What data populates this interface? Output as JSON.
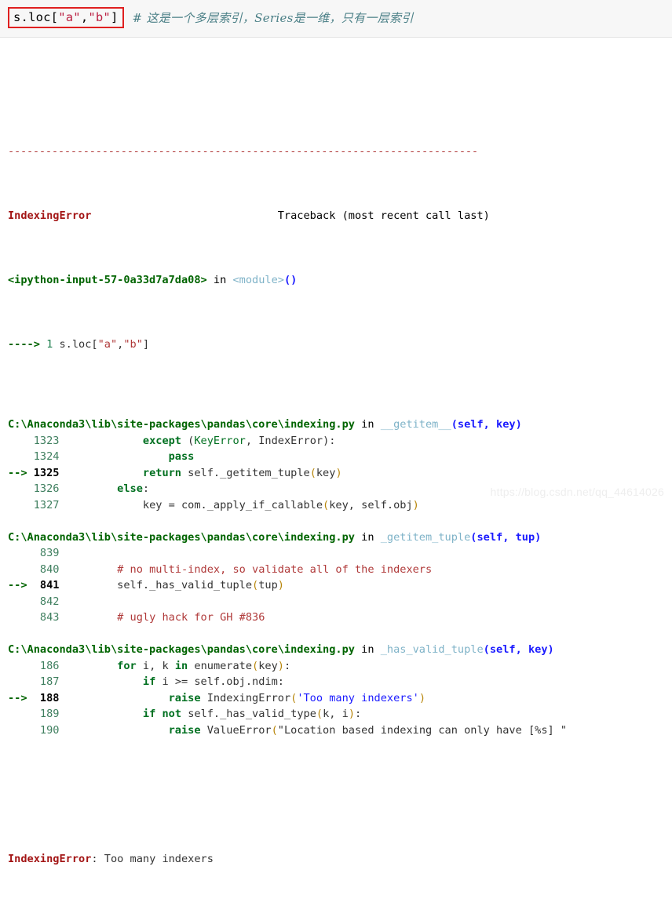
{
  "input_cell": {
    "code_prefix": "s.loc[",
    "code_str_a": "\"a\"",
    "code_comma": ",",
    "code_str_b": "\"b\"",
    "code_suffix": "]",
    "code_full": "s.loc[\"a\",\"b\"]",
    "comment": "# 这是一个多层索引，Series是一维，只有一层索引",
    "highlight_color": "#e02020",
    "background": "#f7f7f7"
  },
  "traceback": {
    "separator": "---------------------------------------------------------------------------",
    "exception_name": "IndexingError",
    "header_right": "Traceback (most recent call last)",
    "cell_ref": "<ipython-input-57-0a33d7a7da08>",
    "cell_in": " in ",
    "cell_scope": "<module>",
    "cell_parens": "()",
    "call_arrow": "----> ",
    "call_lineno": "1 ",
    "call_code_prefix": "s.loc[",
    "call_str_a": "\"a\"",
    "call_comma": ",",
    "call_str_b": "\"b\"",
    "call_suffix": "]",
    "frames": [
      {
        "path": "C:\\Anaconda3\\lib\\site-packages\\pandas\\core\\indexing.py",
        "in": " in ",
        "func": "__getitem__",
        "args": "(self, key)",
        "lines": [
          {
            "marker": "   ",
            "no": "1323",
            "current": false,
            "indent": "            ",
            "tokens": [
              {
                "t": "except",
                "c": "kw"
              },
              {
                "t": " (",
                "c": "plain"
              },
              {
                "t": "KeyError",
                "c": "builtin"
              },
              {
                "t": ", ",
                "c": "plain"
              },
              {
                "t": "IndexError",
                "c": "ident"
              },
              {
                "t": "):",
                "c": "plain"
              }
            ]
          },
          {
            "marker": "   ",
            "no": "1324",
            "current": false,
            "indent": "                ",
            "tokens": [
              {
                "t": "pass",
                "c": "kw"
              }
            ]
          },
          {
            "marker": "-> ",
            "no": "1325",
            "current": true,
            "indent": "            ",
            "tokens": [
              {
                "t": "return",
                "c": "kw"
              },
              {
                "t": " self._getitem_tuple",
                "c": "ident"
              },
              {
                "t": "(",
                "c": "paren-y"
              },
              {
                "t": "key",
                "c": "ident"
              },
              {
                "t": ")",
                "c": "paren-y"
              }
            ]
          },
          {
            "marker": "   ",
            "no": "1326",
            "current": false,
            "indent": "        ",
            "tokens": [
              {
                "t": "else",
                "c": "kw"
              },
              {
                "t": ":",
                "c": "plain"
              }
            ]
          },
          {
            "marker": "   ",
            "no": "1327",
            "current": false,
            "indent": "            ",
            "tokens": [
              {
                "t": "key = com._apply_if_callable",
                "c": "ident"
              },
              {
                "t": "(",
                "c": "paren-y"
              },
              {
                "t": "key, self.obj",
                "c": "ident"
              },
              {
                "t": ")",
                "c": "paren-y"
              }
            ]
          }
        ]
      },
      {
        "path": "C:\\Anaconda3\\lib\\site-packages\\pandas\\core\\indexing.py",
        "in": " in ",
        "func": "_getitem_tuple",
        "args": "(self, tup)",
        "lines": [
          {
            "marker": "   ",
            "no": "839",
            "current": false,
            "indent": "",
            "tokens": []
          },
          {
            "marker": "   ",
            "no": "840",
            "current": false,
            "indent": "        ",
            "tokens": [
              {
                "t": "# no multi-index, so validate all of the indexers",
                "c": "comment"
              }
            ]
          },
          {
            "marker": "-> ",
            "no": "841",
            "current": true,
            "indent": "        ",
            "tokens": [
              {
                "t": "self._has_valid_tuple",
                "c": "ident"
              },
              {
                "t": "(",
                "c": "paren-y"
              },
              {
                "t": "tup",
                "c": "ident"
              },
              {
                "t": ")",
                "c": "paren-y"
              }
            ]
          },
          {
            "marker": "   ",
            "no": "842",
            "current": false,
            "indent": "",
            "tokens": []
          },
          {
            "marker": "   ",
            "no": "843",
            "current": false,
            "indent": "        ",
            "tokens": [
              {
                "t": "# ugly hack for GH #836",
                "c": "comment"
              }
            ]
          }
        ]
      },
      {
        "path": "C:\\Anaconda3\\lib\\site-packages\\pandas\\core\\indexing.py",
        "in": " in ",
        "func": "_has_valid_tuple",
        "args": "(self, key)",
        "lines": [
          {
            "marker": "   ",
            "no": "186",
            "current": false,
            "indent": "        ",
            "tokens": [
              {
                "t": "for",
                "c": "kw"
              },
              {
                "t": " i, k ",
                "c": "ident"
              },
              {
                "t": "in",
                "c": "kw"
              },
              {
                "t": " enumerate",
                "c": "ident"
              },
              {
                "t": "(",
                "c": "paren-y"
              },
              {
                "t": "key",
                "c": "ident"
              },
              {
                "t": ")",
                "c": "paren-y"
              },
              {
                "t": ":",
                "c": "plain"
              }
            ]
          },
          {
            "marker": "   ",
            "no": "187",
            "current": false,
            "indent": "            ",
            "tokens": [
              {
                "t": "if",
                "c": "kw"
              },
              {
                "t": " i >= self.obj.ndim:",
                "c": "ident"
              }
            ]
          },
          {
            "marker": "-> ",
            "no": "188",
            "current": true,
            "indent": "                ",
            "tokens": [
              {
                "t": "raise",
                "c": "kw"
              },
              {
                "t": " IndexingError",
                "c": "ident"
              },
              {
                "t": "(",
                "c": "paren-y"
              },
              {
                "t": "'Too many indexers'",
                "c": "string"
              },
              {
                "t": ")",
                "c": "paren-y"
              }
            ]
          },
          {
            "marker": "   ",
            "no": "189",
            "current": false,
            "indent": "            ",
            "tokens": [
              {
                "t": "if",
                "c": "kw"
              },
              {
                "t": " ",
                "c": "plain"
              },
              {
                "t": "not",
                "c": "kw"
              },
              {
                "t": " self._has_valid_type",
                "c": "ident"
              },
              {
                "t": "(",
                "c": "paren-y"
              },
              {
                "t": "k, i",
                "c": "ident"
              },
              {
                "t": ")",
                "c": "paren-y"
              },
              {
                "t": ":",
                "c": "plain"
              }
            ]
          },
          {
            "marker": "   ",
            "no": "190",
            "current": false,
            "indent": "                ",
            "tokens": [
              {
                "t": "raise",
                "c": "kw"
              },
              {
                "t": " ValueError",
                "c": "ident"
              },
              {
                "t": "(",
                "c": "paren-y"
              },
              {
                "t": "\"Location based indexing can only have [%s] \"",
                "c": "string2"
              }
            ]
          }
        ]
      }
    ],
    "final_error_name": "IndexingError",
    "final_error_sep": ": ",
    "final_error_message": "Too many indexers"
  },
  "watermark": "https://blog.csdn.net/qq_44614026"
}
